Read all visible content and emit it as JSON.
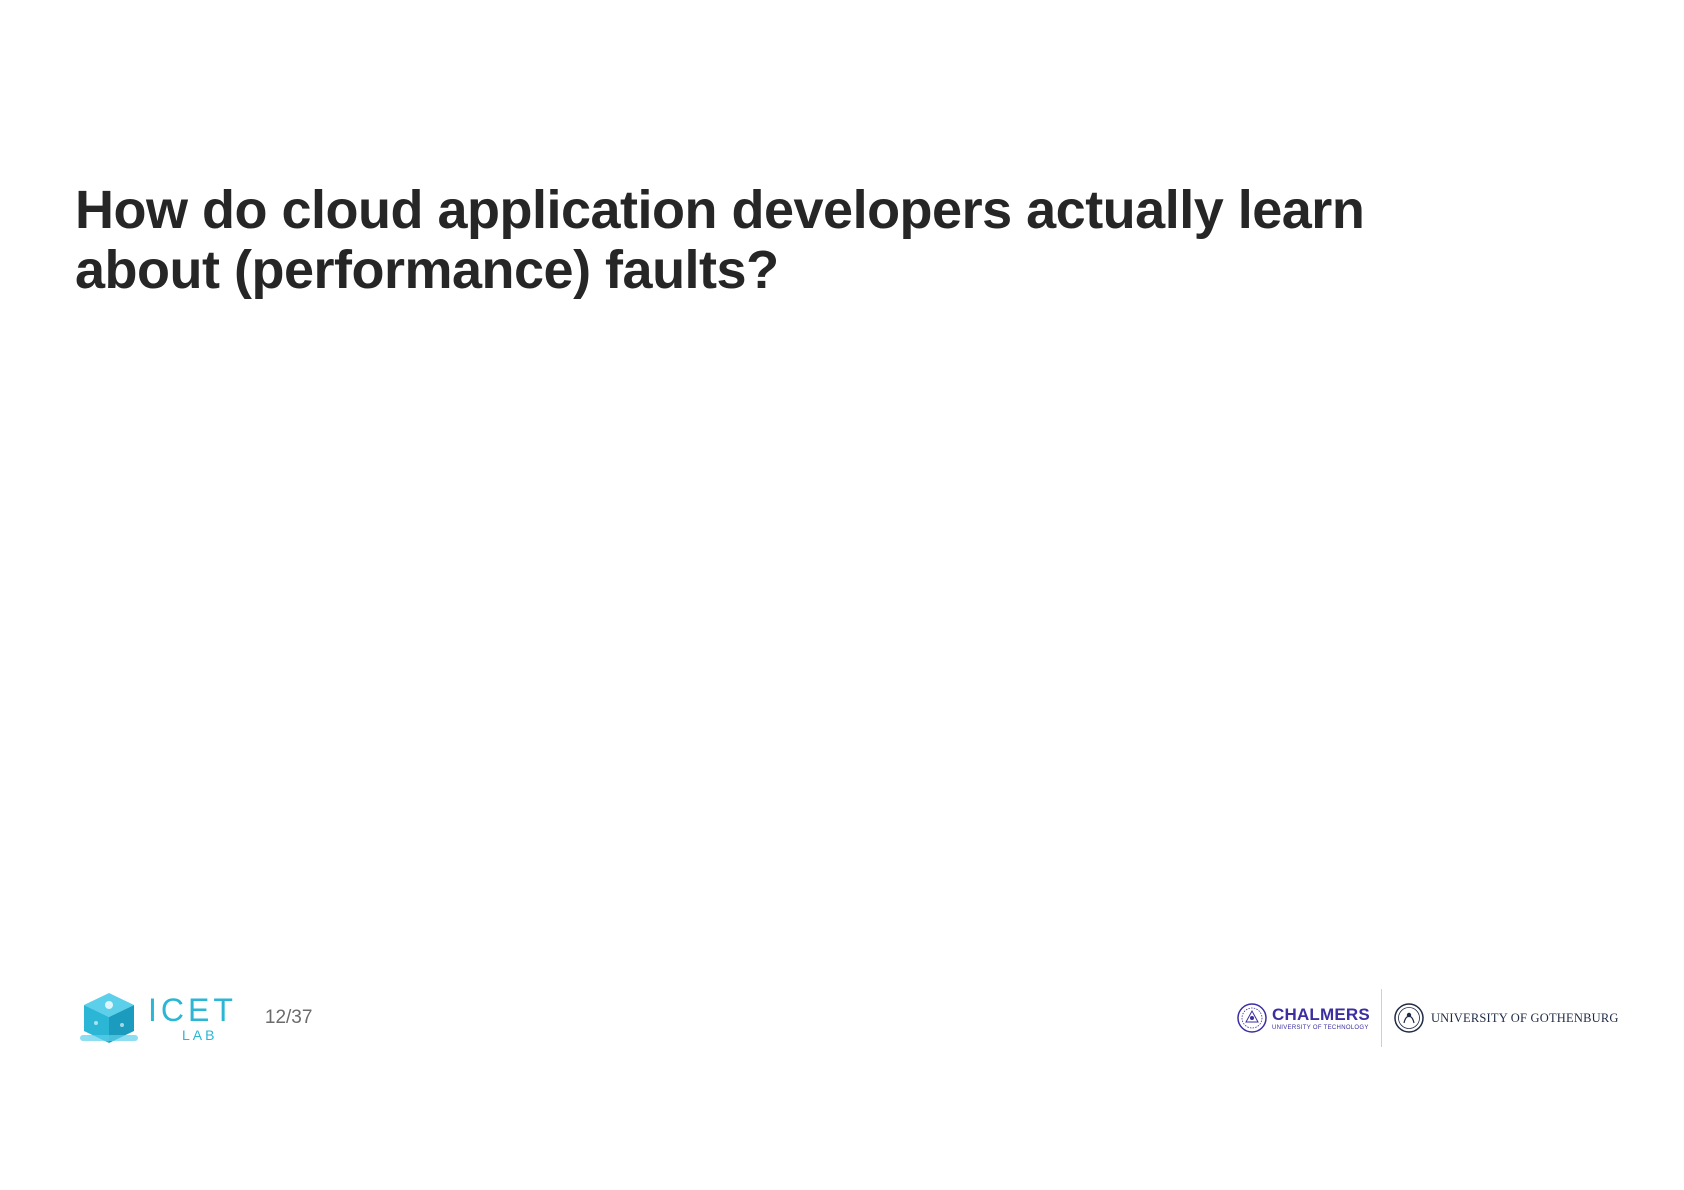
{
  "slide": {
    "title_lines": [
      "How do cloud application developers actually learn",
      "about (performance) faults?"
    ],
    "page_number": "12/37"
  },
  "logos": {
    "icet": {
      "main": "ICET",
      "sub": "LAB",
      "color": "#2bb6d6"
    },
    "chalmers": {
      "name": "CHALMERS",
      "sub": "UNIVERSITY OF TECHNOLOGY",
      "color": "#3b2ea3"
    },
    "gothenburg": {
      "name": "UNIVERSITY OF GOTHENBURG",
      "color": "#1f2a44"
    }
  }
}
